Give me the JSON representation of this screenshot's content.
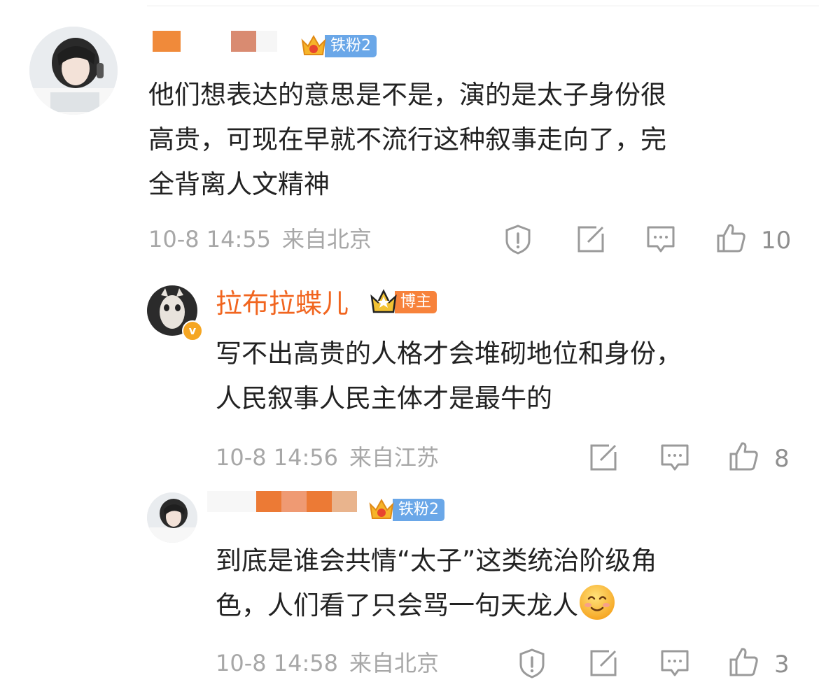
{
  "comments": [
    {
      "badge": "铁粉2",
      "text_lines": [
        "他们想表达的意思是不是，演的是太子身份很",
        "高贵，可现在早就不流行这种叙事走向了，完",
        "全背离人文精神"
      ],
      "time": "10-8 14:55",
      "location": "来自北京",
      "likes": "10"
    },
    {
      "username": "拉布拉蝶儿",
      "badge": "博主",
      "text_lines": [
        "写不出高贵的人格才会堆砌地位和身份，",
        "人民叙事人民主体才是最牛的"
      ],
      "time": "10-8 14:56",
      "location": "来自江苏",
      "likes": "8"
    },
    {
      "badge": "铁粉2",
      "text_lines": [
        "到底是谁会共情“太子”这类统治阶级角",
        "色，人们看了只会骂一句天龙人"
      ],
      "time": "10-8 14:58",
      "location": "来自北京",
      "likes": "3"
    }
  ],
  "icons": {
    "report": "exclamation-shield-icon",
    "repost": "share-square-icon",
    "reply": "comment-bubble-icon",
    "like": "thumbs-up-icon",
    "emoji": "smiling-face-icon"
  },
  "colors": {
    "username": "#f1651f",
    "fan_badge": "#6aa7e8",
    "host_badge": "#f7823b",
    "meta": "#a7a7a7",
    "text": "#222222"
  }
}
